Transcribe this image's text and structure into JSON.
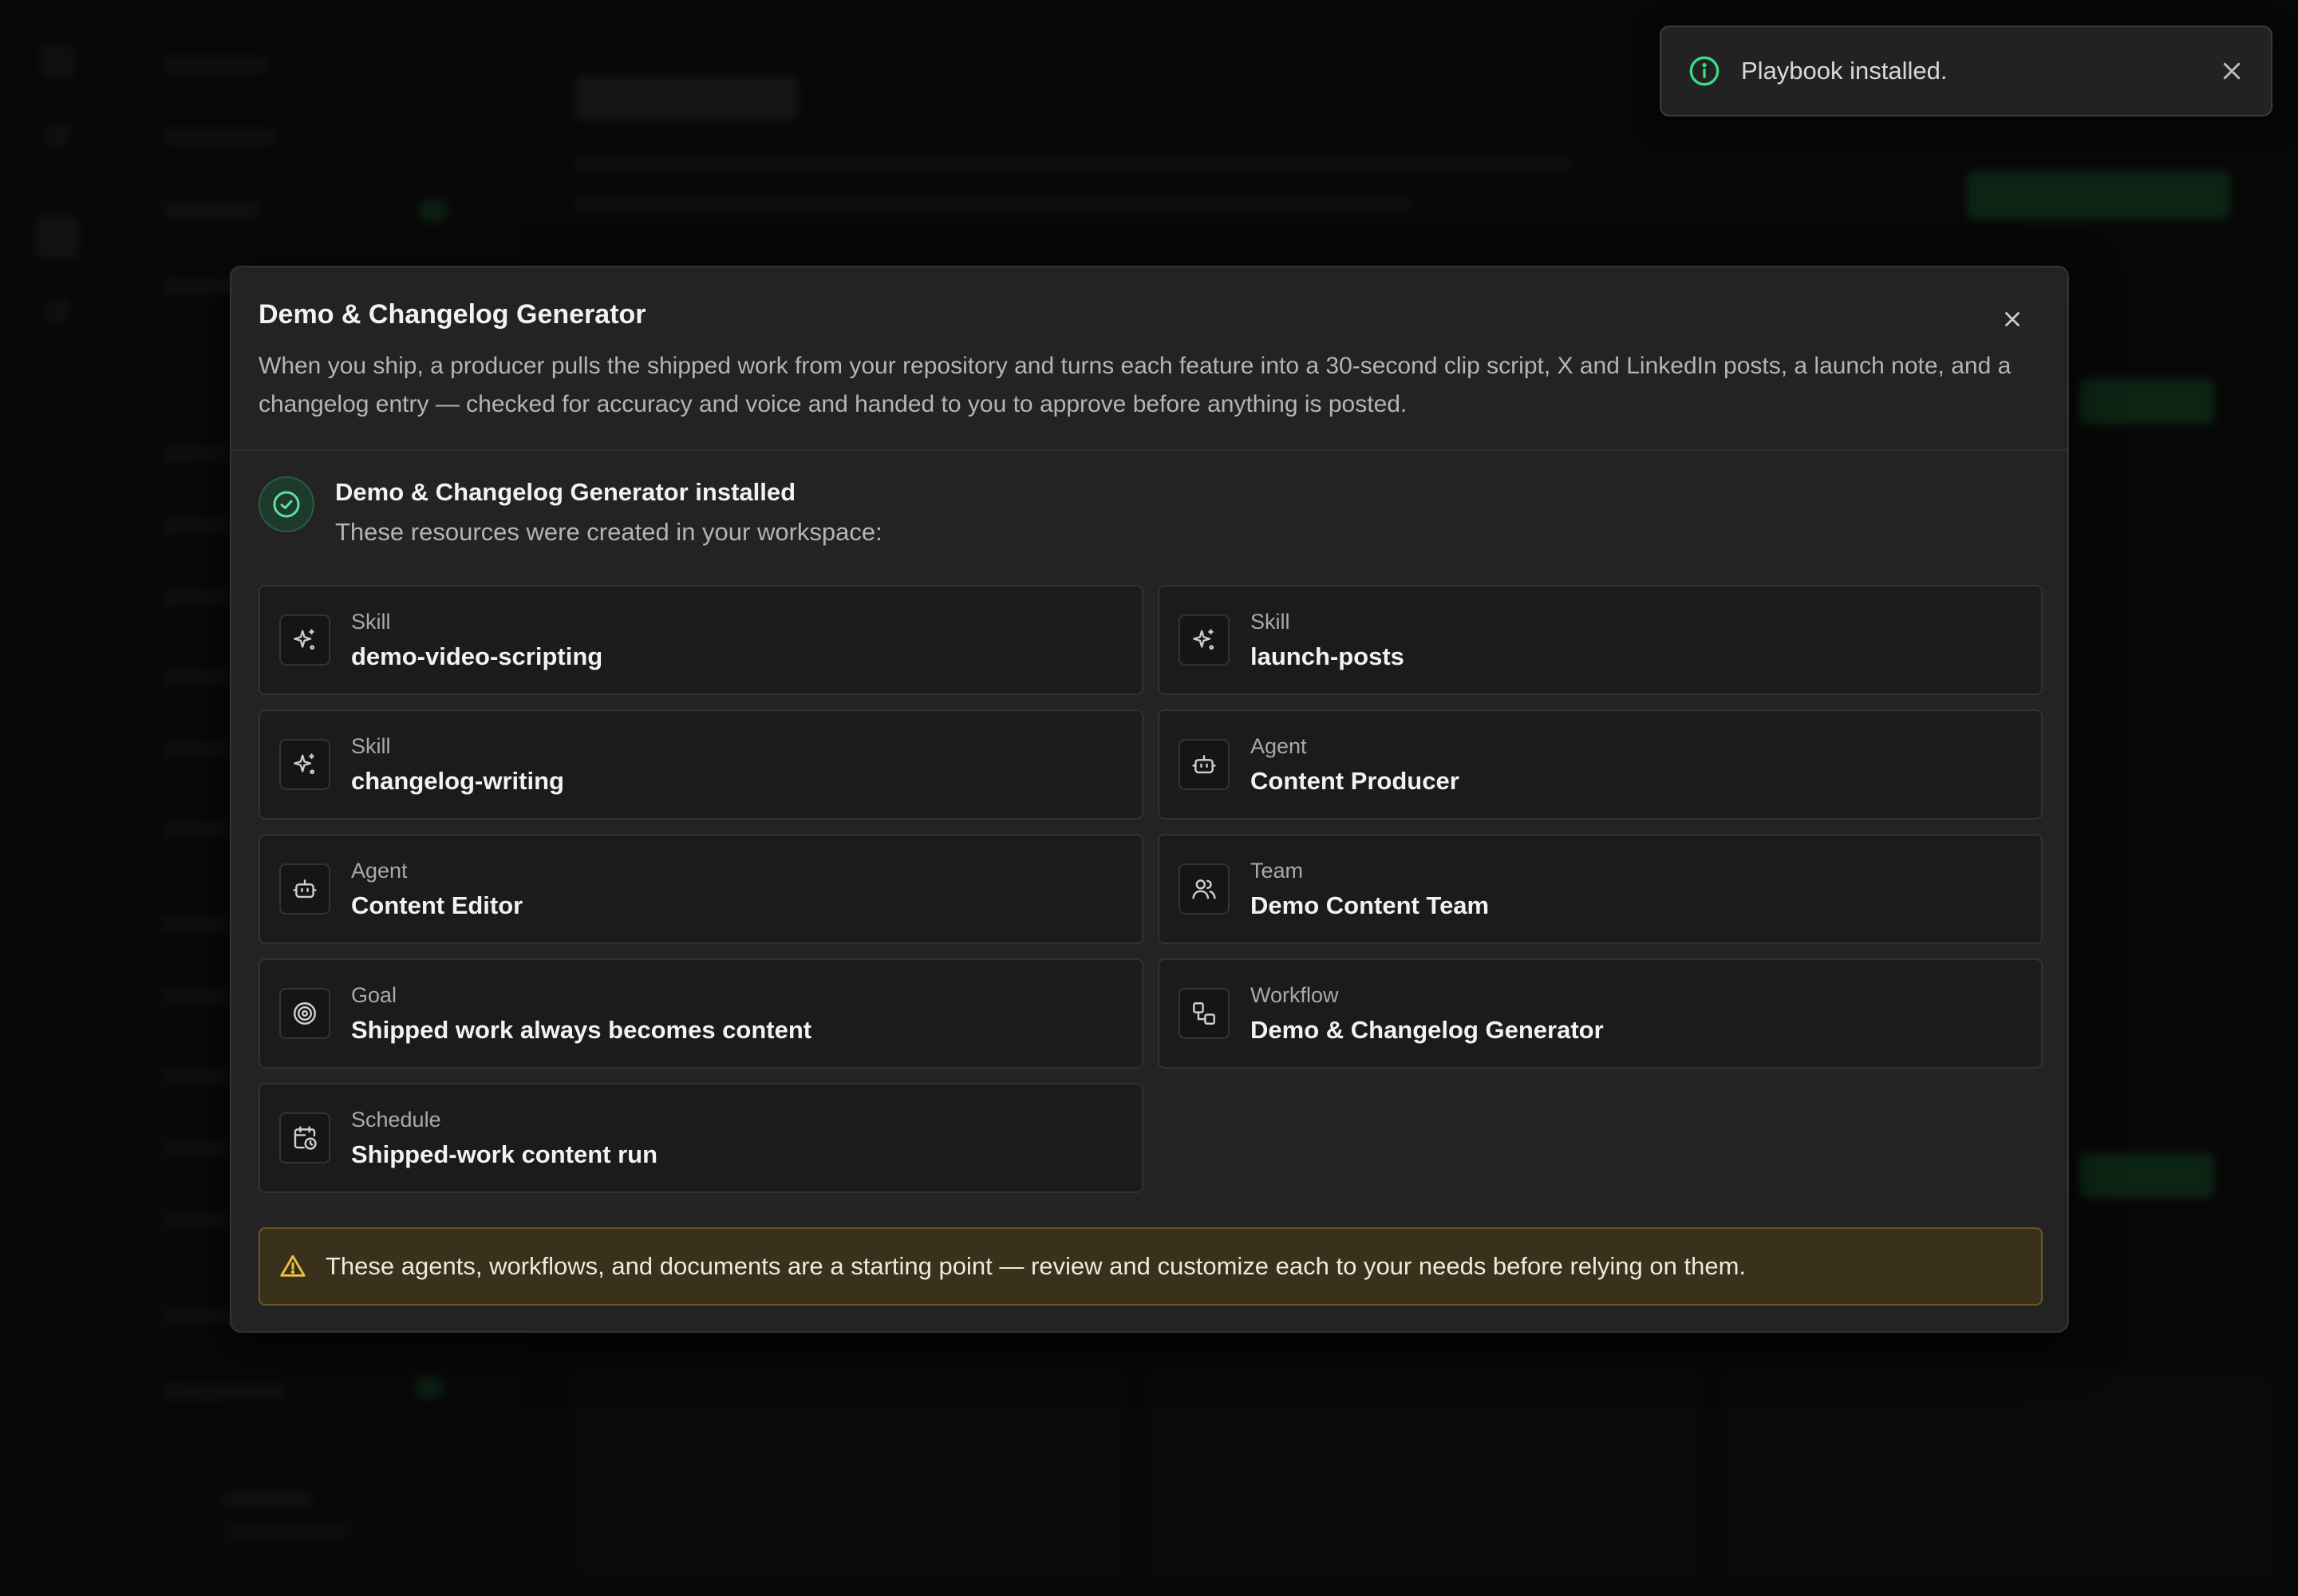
{
  "colors": {
    "accent_green": "#3ddc84",
    "warning_yellow": "#f0c340",
    "modal_bg": "#232323",
    "card_bg": "#1b1b1b"
  },
  "toast": {
    "icon": "info-icon",
    "message": "Playbook installed."
  },
  "modal": {
    "title": "Demo & Changelog Generator",
    "description": "When you ship, a producer pulls the shipped work from your repository and turns each feature into a 30-second clip script, X and LinkedIn posts, a launch note, and a changelog entry — checked for accuracy and voice and handed to you to approve before anything is posted.",
    "success": {
      "title": "Demo & Changelog Generator installed",
      "subtitle": "These resources were created in your workspace:"
    },
    "resources": [
      {
        "type": "Skill",
        "name": "demo-video-scripting",
        "icon": "sparkles-icon"
      },
      {
        "type": "Skill",
        "name": "launch-posts",
        "icon": "sparkles-icon"
      },
      {
        "type": "Skill",
        "name": "changelog-writing",
        "icon": "sparkles-icon"
      },
      {
        "type": "Agent",
        "name": "Content Producer",
        "icon": "bot-icon"
      },
      {
        "type": "Agent",
        "name": "Content Editor",
        "icon": "bot-icon"
      },
      {
        "type": "Team",
        "name": "Demo Content Team",
        "icon": "users-icon"
      },
      {
        "type": "Goal",
        "name": "Shipped work always becomes content",
        "icon": "target-icon"
      },
      {
        "type": "Workflow",
        "name": "Demo & Changelog Generator",
        "icon": "workflow-icon"
      },
      {
        "type": "Schedule",
        "name": "Shipped-work content run",
        "icon": "calendar-clock-icon"
      }
    ],
    "warning": "These agents, workflows, and documents are a starting point — review and customize each to your needs before relying on them."
  }
}
